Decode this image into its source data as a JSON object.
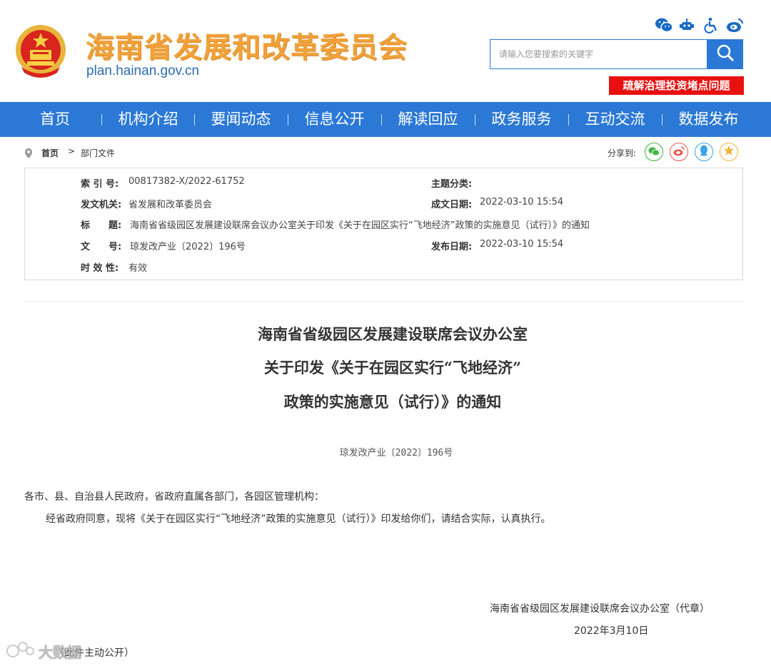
{
  "header": {
    "site_title": "海南省发展和改革委员会",
    "site_url": "plan.hainan.gov.cn",
    "search_placeholder": "请输入您要搜索的关键字",
    "promo_label": "疏解治理投资堵点问题",
    "top_icons": [
      "wechat-icon",
      "robot-icon",
      "accessibility-icon",
      "weibo-icon"
    ]
  },
  "nav": {
    "items": [
      "首页",
      "机构介绍",
      "要闻动态",
      "信息公开",
      "解读回应",
      "政务服务",
      "互动交流",
      "数据发布"
    ]
  },
  "breadcrumb": {
    "home": "首页",
    "separator": ">",
    "current": "部门文件",
    "share_label": "分享到:"
  },
  "meta": {
    "index_label": "索 引 号:",
    "index_value": "00817382-X/2022-61752",
    "topic_label": "主题分类:",
    "topic_value": "",
    "issuer_label": "发文机关:",
    "issuer_value": "省发展和改革委员会",
    "created_label": "成文日期:",
    "created_value": "2022-03-10 15:54",
    "title_label": "标　　题:",
    "title_value": "海南省省级园区发展建设联席会议办公室关于印发《关于在园区实行“飞地经济”政策的实施意见（试行）》的通知",
    "docno_label": "文　　号:",
    "docno_value": "琼发改产业〔2022〕196号",
    "published_label": "发布日期:",
    "published_value": "2022-03-10 15:54",
    "validity_label": "时 效 性:",
    "validity_value": "有效"
  },
  "document": {
    "title_line1": "海南省省级园区发展建设联席会议办公室",
    "title_line2": "关于印发《关于在园区实行“飞地经济”",
    "title_line3": "政策的实施意见（试行）》的通知",
    "doc_number": "琼发改产业〔2022〕196号",
    "salutation": "各市、县、自治县人民政府，省政府直属各部门，各园区管理机构：",
    "paragraph": "经省政府同意，现将《关于在园区实行“飞地经济”政策的实施意见（试行）》印发给你们，请结合实际，认真执行。",
    "signature": "海南省省级园区发展建设联席会议办公室（代章）",
    "date": "2022年3月10日",
    "disclosure": "（此件主动公开）",
    "watermark": "大数据"
  },
  "colors": {
    "nav_bg": "#2b78d6",
    "title_orange": "#f0a13a",
    "promo_red": "#e8110f"
  }
}
